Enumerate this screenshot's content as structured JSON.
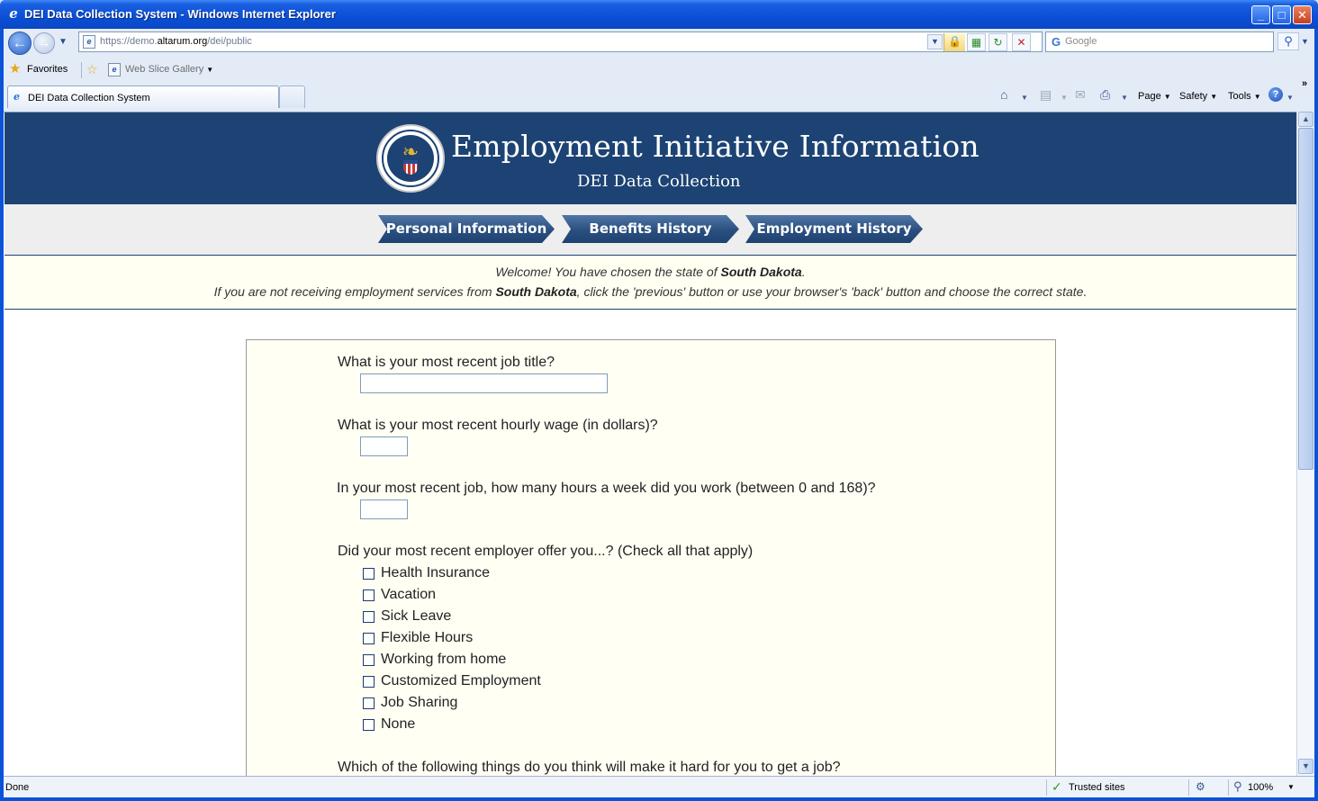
{
  "window": {
    "title": "DEI Data Collection System - Windows Internet Explorer",
    "minimize": "_",
    "maximize": "□",
    "close": "✕"
  },
  "address": {
    "url_prefix": "https://demo.",
    "url_host": "altarum.org",
    "url_path": "/dei/public"
  },
  "search": {
    "placeholder": "Google"
  },
  "favorites": {
    "label": "Favorites",
    "web_slice": "Web Slice Gallery"
  },
  "tab": {
    "label": "DEI Data Collection System"
  },
  "commands": {
    "page": "Page",
    "safety": "Safety",
    "tools": "Tools"
  },
  "site": {
    "title": "Employment Initiative Information",
    "subtitle": "DEI Data Collection"
  },
  "steps": [
    "Personal Information",
    "Benefits History",
    "Employment History"
  ],
  "welcome": {
    "line1_pre": "Welcome! You have chosen the state of ",
    "state": "South Dakota",
    "line1_post": ".",
    "line2_pre": "If you are not receiving employment services from ",
    "line2_post": ", click the 'previous' button or use your browser's 'back' button and choose the correct state."
  },
  "form": {
    "q_job_title": "What is your most recent job title?",
    "job_title_value": "",
    "q_hourly_wage": "What is your most recent hourly wage (in dollars)?",
    "hourly_wage_value": "",
    "q_hours_week": "In your most recent job, how many hours a week did you work (between 0 and 168)?",
    "hours_week_value": "",
    "q_benefits": "Did your most recent employer offer you...? (Check all that apply)",
    "benefits": [
      {
        "label": "Health Insurance",
        "checked": false
      },
      {
        "label": "Vacation",
        "checked": false
      },
      {
        "label": "Sick Leave",
        "checked": false
      },
      {
        "label": "Flexible Hours",
        "checked": false
      },
      {
        "label": "Working from home",
        "checked": false
      },
      {
        "label": "Customized Employment",
        "checked": false
      },
      {
        "label": "Job Sharing",
        "checked": false
      },
      {
        "label": "None",
        "checked": false
      }
    ],
    "q_barriers": "Which of the following things do you think will make it hard for you to get a job?"
  },
  "status": {
    "text": "Done",
    "zone": "Trusted sites",
    "zoom": "100%"
  },
  "colors": {
    "header_bg": "#1c4373",
    "form_bg": "#fffff4",
    "welcome_bg": "#fffff2"
  }
}
